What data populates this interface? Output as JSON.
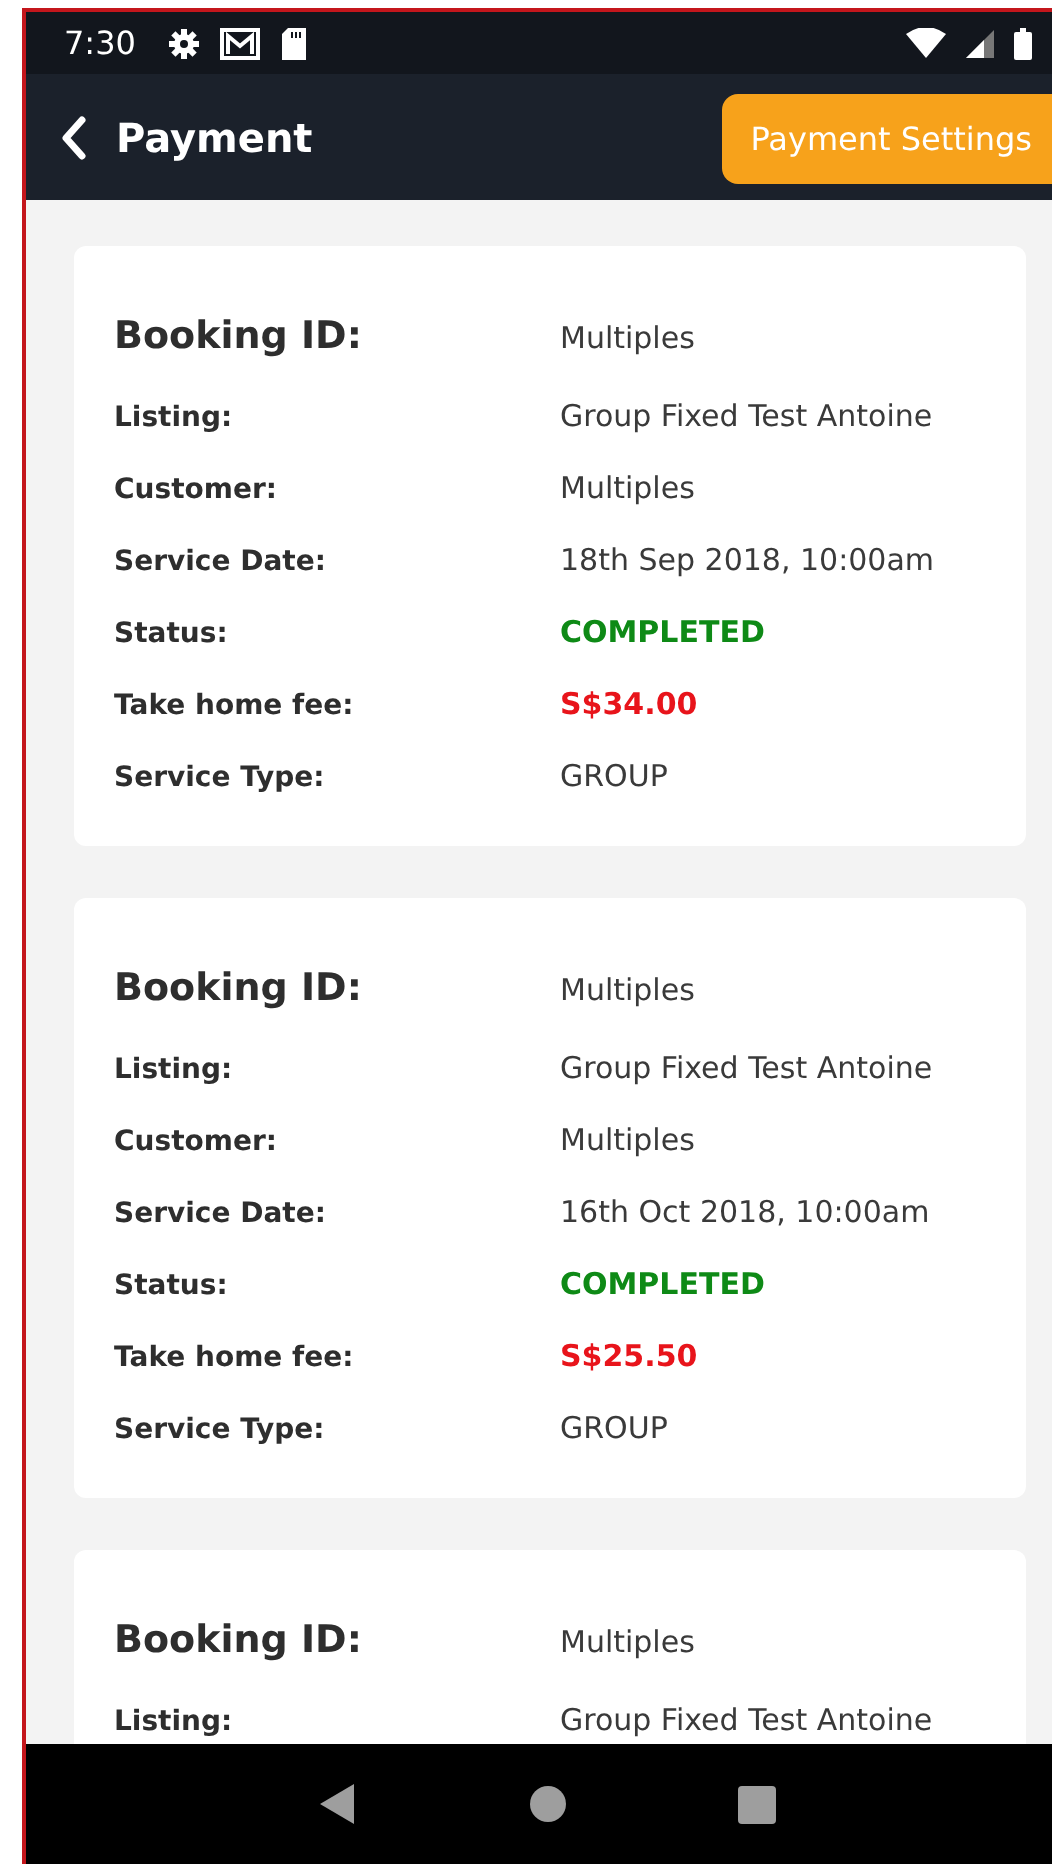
{
  "status_bar": {
    "time": "7:30"
  },
  "header": {
    "title": "Payment",
    "action_button": "Payment Settings"
  },
  "cards": [
    {
      "fields": [
        {
          "kind": "id",
          "label": "Booking ID:",
          "value": "Multiples"
        },
        {
          "kind": "plain",
          "label": "Listing:",
          "value": "Group Fixed Test Antoine"
        },
        {
          "kind": "plain",
          "label": "Customer:",
          "value": "Multiples"
        },
        {
          "kind": "plain",
          "label": "Service Date:",
          "value": "18th Sep 2018, 10:00am"
        },
        {
          "kind": "status",
          "label": "Status:",
          "value": "COMPLETED"
        },
        {
          "kind": "fee",
          "label": "Take home fee:",
          "value": "S$34.00"
        },
        {
          "kind": "plain",
          "label": "Service Type:",
          "value": "GROUP"
        }
      ]
    },
    {
      "fields": [
        {
          "kind": "id",
          "label": "Booking ID:",
          "value": "Multiples"
        },
        {
          "kind": "plain",
          "label": "Listing:",
          "value": "Group Fixed Test Antoine"
        },
        {
          "kind": "plain",
          "label": "Customer:",
          "value": "Multiples"
        },
        {
          "kind": "plain",
          "label": "Service Date:",
          "value": "16th Oct 2018, 10:00am"
        },
        {
          "kind": "status",
          "label": "Status:",
          "value": "COMPLETED"
        },
        {
          "kind": "fee",
          "label": "Take home fee:",
          "value": "S$25.50"
        },
        {
          "kind": "plain",
          "label": "Service Type:",
          "value": "GROUP"
        }
      ]
    },
    {
      "fields": [
        {
          "kind": "id",
          "label": "Booking ID:",
          "value": "Multiples"
        },
        {
          "kind": "plain",
          "label": "Listing:",
          "value": "Group Fixed Test Antoine"
        }
      ]
    }
  ]
}
